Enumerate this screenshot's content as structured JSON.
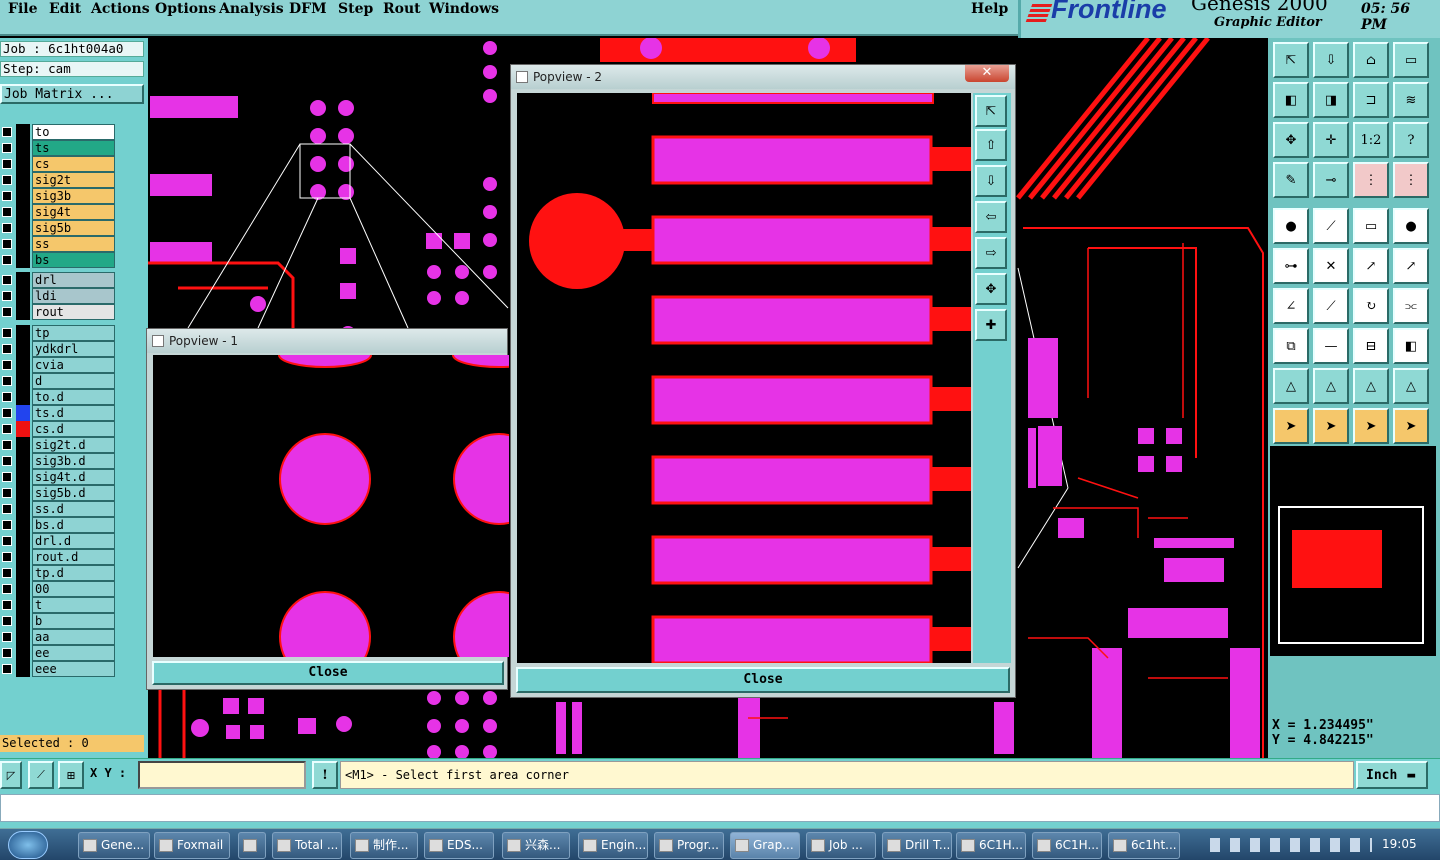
{
  "menu": [
    "File",
    "Edit",
    "Actions",
    "Options",
    "Analysis",
    "DFM",
    "Step",
    "Rout",
    "Windows"
  ],
  "help": "Help",
  "brand": {
    "logo": "Frontline",
    "product": "Genesis 2000",
    "subtitle": "Graphic Editor",
    "time": "05: 56  PM"
  },
  "job": {
    "job": "Job : 6c1ht004a0",
    "step": "Step: cam",
    "matrix": "Job Matrix ..."
  },
  "layers": [
    {
      "name": "to",
      "bg": "#ffffff",
      "clr": "#000"
    },
    {
      "name": "ts",
      "bg": "#22a887",
      "clr": "#000"
    },
    {
      "name": "cs",
      "bg": "#f5c76b",
      "clr": "#000"
    },
    {
      "name": "sig2t",
      "bg": "#f5c76b",
      "clr": "#000"
    },
    {
      "name": "sig3b",
      "bg": "#f5c76b",
      "clr": "#000"
    },
    {
      "name": "sig4t",
      "bg": "#f5c76b",
      "clr": "#000"
    },
    {
      "name": "sig5b",
      "bg": "#f5c76b",
      "clr": "#000"
    },
    {
      "name": "ss",
      "bg": "#f5c76b",
      "clr": "#000"
    },
    {
      "name": "bs",
      "bg": "#22a887",
      "clr": "#000"
    },
    {
      "name": "drl",
      "bg": "#a8c6cc",
      "clr": "#000"
    },
    {
      "name": "ldi",
      "bg": "#a8c6cc",
      "clr": "#000"
    },
    {
      "name": "rout",
      "bg": "#e4e4e4",
      "clr": "#000"
    },
    {
      "name": "tp",
      "bg": "#8ed3d3",
      "clr": "#000"
    },
    {
      "name": "ydkdrl",
      "bg": "#8ed3d3",
      "clr": "#000"
    },
    {
      "name": "cvia",
      "bg": "#8ed3d3",
      "clr": "#000"
    },
    {
      "name": "d",
      "bg": "#8ed3d3",
      "clr": "#000"
    },
    {
      "name": "to.d",
      "bg": "#8ed3d3",
      "clr": "#000"
    },
    {
      "name": "ts.d",
      "bg": "#8ed3d3",
      "clr": "#2244ee"
    },
    {
      "name": "cs.d",
      "bg": "#8ed3d3",
      "clr": "#ee1111"
    },
    {
      "name": "sig2t.d",
      "bg": "#8ed3d3",
      "clr": "#000"
    },
    {
      "name": "sig3b.d",
      "bg": "#8ed3d3",
      "clr": "#000"
    },
    {
      "name": "sig4t.d",
      "bg": "#8ed3d3",
      "clr": "#000"
    },
    {
      "name": "sig5b.d",
      "bg": "#8ed3d3",
      "clr": "#000"
    },
    {
      "name": "ss.d",
      "bg": "#8ed3d3",
      "clr": "#000"
    },
    {
      "name": "bs.d",
      "bg": "#8ed3d3",
      "clr": "#000"
    },
    {
      "name": "drl.d",
      "bg": "#8ed3d3",
      "clr": "#000"
    },
    {
      "name": "rout.d",
      "bg": "#8ed3d3",
      "clr": "#000"
    },
    {
      "name": "tp.d",
      "bg": "#8ed3d3",
      "clr": "#000"
    },
    {
      "name": "00",
      "bg": "#8ed3d3",
      "clr": "#000"
    },
    {
      "name": "t",
      "bg": "#8ed3d3",
      "clr": "#000"
    },
    {
      "name": "b",
      "bg": "#8ed3d3",
      "clr": "#000"
    },
    {
      "name": "aa",
      "bg": "#8ed3d3",
      "clr": "#000"
    },
    {
      "name": "ee",
      "bg": "#8ed3d3",
      "clr": "#000"
    },
    {
      "name": "eee",
      "bg": "#8ed3d3",
      "clr": "#000"
    }
  ],
  "selected": "Selected : 0",
  "popview1": {
    "title": "Popview - 1",
    "close": "Close"
  },
  "popview2": {
    "title": "Popview - 2",
    "close": "Close"
  },
  "coords": {
    "x": "X = 1.234495\"",
    "y": "Y = 4.842215\""
  },
  "status": {
    "xy_label": "X Y :",
    "xy_value": "",
    "prompt": "<M1> - Select first area corner",
    "units": "Inch"
  },
  "taskbar": [
    "Gene...",
    "Foxmail",
    "",
    "Total ...",
    "制作...",
    "EDS...",
    "兴森...",
    "Engin...",
    "Progr...",
    "Grap...",
    "Job ...",
    "Drill T...",
    "6C1H...",
    "6C1H...",
    "6c1ht..."
  ],
  "clock": "19:05",
  "colors": {
    "pad": "#e633e6",
    "copper": "#ff1111",
    "panel": "#73d0cf"
  }
}
